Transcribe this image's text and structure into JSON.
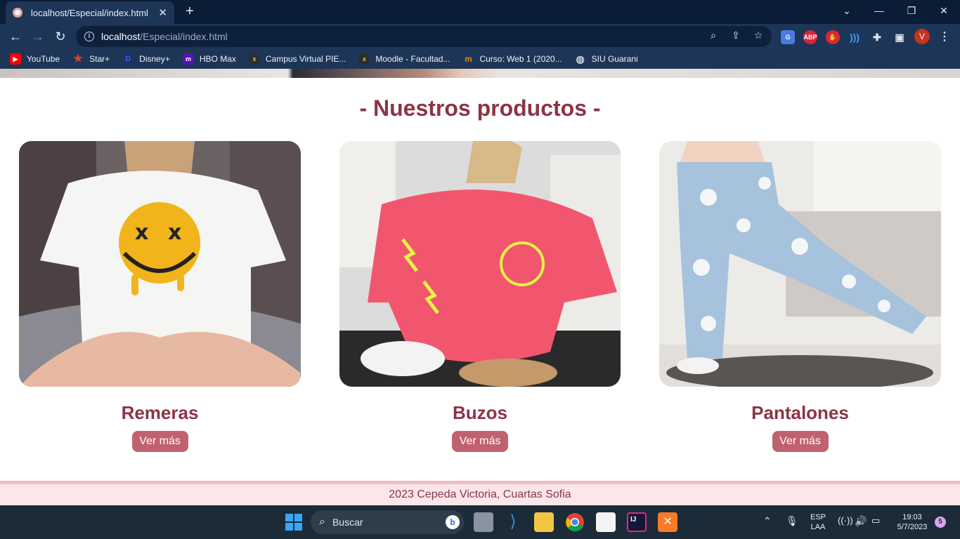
{
  "browser": {
    "tab_title": "localhost/Especial/index.html",
    "url_host": "localhost",
    "url_path": "/Especial/index.html",
    "profile_initial": "V",
    "extensions": [
      "translate-icon",
      "abp-icon",
      "hand-icon",
      "wifi-ext-icon",
      "puzzle-icon",
      "sidepanel-icon"
    ],
    "bookmarks": [
      {
        "label": "YouTube",
        "icon": "youtube-icon",
        "color": "#ff0000"
      },
      {
        "label": "Star+",
        "icon": "star-icon",
        "color": "#d9372b"
      },
      {
        "label": "Disney+",
        "icon": "disney-icon",
        "color": "#1a3bd1"
      },
      {
        "label": "HBO Max",
        "icon": "hbo-icon",
        "color": "#5b14b0"
      },
      {
        "label": "Campus Virtual PIE...",
        "icon": "campus-icon",
        "color": "#2b2b2b"
      },
      {
        "label": "Moodle - Facultad...",
        "icon": "moodle-icon",
        "color": "#2b2b2b"
      },
      {
        "label": "Curso: Web 1 (2020...",
        "icon": "moodle-m-icon",
        "color": "#f98012"
      },
      {
        "label": "SIU Guarani",
        "icon": "globe-icon",
        "color": "#5d6b7d"
      }
    ]
  },
  "page": {
    "section_title": "- Nuestros productos -",
    "products": [
      {
        "name": "Remeras",
        "button": "Ver más"
      },
      {
        "name": "Buzos",
        "button": "Ver más"
      },
      {
        "name": "Pantalones",
        "button": "Ver más"
      }
    ],
    "footer": "2023 Cepeda Victoria, Cuartas Sofia"
  },
  "taskbar": {
    "search_placeholder": "Buscar",
    "language": "ESP",
    "layout": "LAA",
    "time": "19:03",
    "date": "5/7/2023",
    "notifications": "5"
  }
}
